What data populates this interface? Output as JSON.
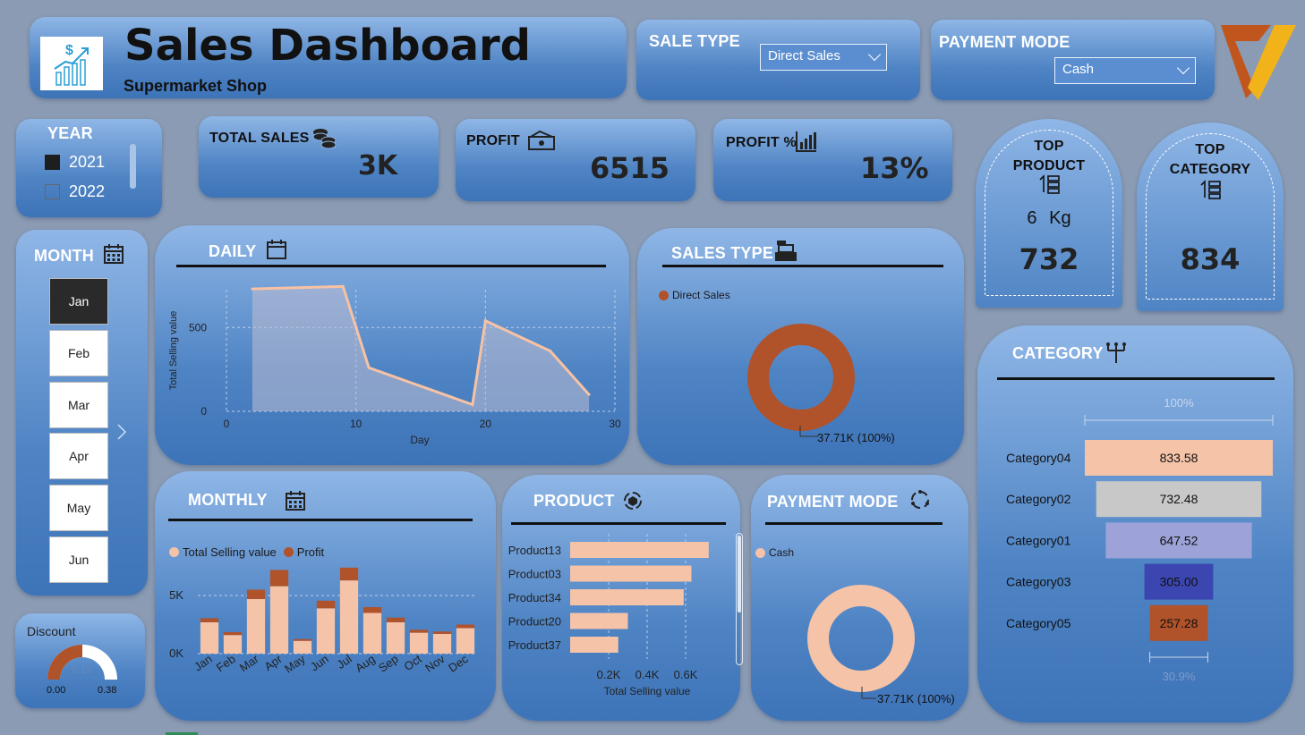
{
  "header": {
    "title": "Sales Dashboard",
    "subtitle": "Supermarket Shop"
  },
  "filters": {
    "sale_type": {
      "label": "SALE TYPE",
      "value": "Direct Sales"
    },
    "payment_mode": {
      "label": "PAYMENT MODE",
      "value": "Cash"
    }
  },
  "year": {
    "label": "YEAR",
    "options": [
      "2021",
      "2022"
    ],
    "selected": "2021"
  },
  "kpis": {
    "total_sales": {
      "label": "TOTAL SALES",
      "value": "3K"
    },
    "profit": {
      "label": "PROFIT",
      "value": "6515"
    },
    "profit_pct": {
      "label": "PROFIT %",
      "value": "13%"
    }
  },
  "top_product": {
    "label_1": "TOP",
    "label_2": "PRODUCT",
    "unit_value": "6",
    "unit": "Kg",
    "value": "732"
  },
  "top_category": {
    "label_1": "TOP",
    "label_2": "CATEGORY",
    "value": "834"
  },
  "month": {
    "label": "MONTH",
    "items": [
      "Jan",
      "Feb",
      "Mar",
      "Apr",
      "May",
      "Jun"
    ],
    "selected": "Jan"
  },
  "discount": {
    "label": "Discount",
    "value": 0.19,
    "value_label": "0.19",
    "min": "0.00",
    "max": "0.38"
  },
  "colors": {
    "peach": "#f4c3a8",
    "rust": "#b0522a",
    "accent_line": "#f7c2a4"
  },
  "chart_data": [
    {
      "id": "daily",
      "title": "DAILY",
      "type": "area",
      "xlabel": "Day",
      "ylabel": "Total Selling value",
      "xlim": [
        0,
        30
      ],
      "ylim": [
        0,
        800
      ],
      "xticks": [
        "0",
        "10",
        "20",
        "30"
      ],
      "yticks": [
        "0",
        "500"
      ],
      "x": [
        2,
        9,
        11,
        19,
        20,
        25,
        28
      ],
      "y": [
        730,
        745,
        260,
        40,
        540,
        360,
        100
      ]
    },
    {
      "id": "sales_type",
      "title": "SALES TYPE",
      "type": "pie",
      "legend": [
        "Direct Sales"
      ],
      "values": [
        37.71
      ],
      "label": "37.71K (100%)"
    },
    {
      "id": "monthly",
      "title": "MONTHLY",
      "type": "bar",
      "legend": [
        "Total Selling value",
        "Profit"
      ],
      "categories": [
        "Jan",
        "Feb",
        "Mar",
        "Apr",
        "May",
        "Jun",
        "Jul",
        "Aug",
        "Sep",
        "Oct",
        "Nov",
        "Dec"
      ],
      "yticks": [
        "0K",
        "5K"
      ],
      "ylim": [
        0,
        8000
      ],
      "series": [
        {
          "name": "Total Selling value",
          "values": [
            2700,
            1600,
            4700,
            5800,
            1100,
            3900,
            6300,
            3500,
            2700,
            1800,
            1700,
            2200
          ]
        },
        {
          "name": "Profit",
          "values": [
            350,
            250,
            800,
            1400,
            150,
            650,
            1100,
            500,
            400,
            250,
            200,
            300
          ]
        }
      ]
    },
    {
      "id": "product",
      "title": "PRODUCT",
      "type": "bar",
      "orientation": "horizontal",
      "xlabel": "Total Selling value",
      "categories": [
        "Product13",
        "Product03",
        "Product34",
        "Product20",
        "Product37"
      ],
      "values": [
        720,
        630,
        590,
        300,
        250
      ],
      "xticks": [
        "0.2K",
        "0.4K",
        "0.6K"
      ]
    },
    {
      "id": "payment_mode",
      "title": "PAYMENT MODE",
      "type": "pie",
      "legend": [
        "Cash"
      ],
      "values": [
        37.71
      ],
      "label": "37.71K (100%)"
    },
    {
      "id": "category",
      "title": "CATEGORY",
      "type": "bar",
      "orientation": "funnel",
      "top_label": "100%",
      "bottom_label": "30.9%",
      "categories": [
        "Category04",
        "Category02",
        "Category01",
        "Category03",
        "Category05"
      ],
      "values": [
        833.58,
        732.48,
        647.52,
        305.0,
        257.28
      ],
      "value_labels": [
        "833.58",
        "732.48",
        "647.52",
        "305.00",
        "257.28"
      ],
      "colors": [
        "#f4c3a8",
        "#c8c8c8",
        "#9da3d8",
        "#3b46b0",
        "#b0522a"
      ]
    }
  ]
}
